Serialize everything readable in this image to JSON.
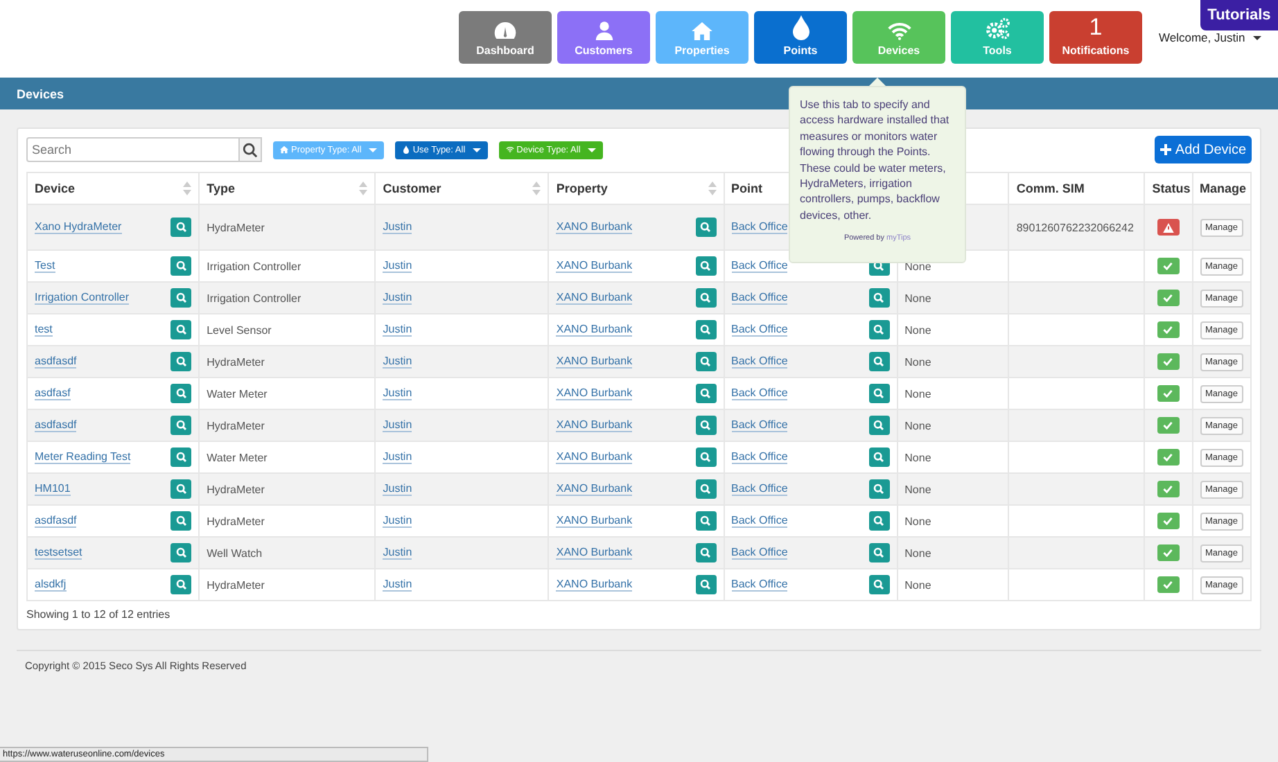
{
  "nav": [
    {
      "label": "Dashboard",
      "color": "#7b7b7b"
    },
    {
      "label": "Customers",
      "color": "#8c70f6"
    },
    {
      "label": "Properties",
      "color": "#5db6fb"
    },
    {
      "label": "Points",
      "color": "#0a6fcf"
    },
    {
      "label": "Devices",
      "color": "#57c35b"
    },
    {
      "label": "Tools",
      "color": "#22c0a0"
    },
    {
      "label": "Notifications",
      "count": "1",
      "color": "#c93f30"
    }
  ],
  "tutorials": "Tutorials",
  "welcome": "Welcome, Justin",
  "page_title": "Devices",
  "search": {
    "placeholder": "Search"
  },
  "filters": [
    {
      "label": "Property Type: All",
      "color": "#5db6fb"
    },
    {
      "label": "Use Type: All",
      "color": "#0b6cc0"
    },
    {
      "label": "Device Type: All",
      "color": "#45b520"
    }
  ],
  "add_button": "Add Device",
  "columns": [
    {
      "label": "Device",
      "sortable": true
    },
    {
      "label": "Type",
      "sortable": true
    },
    {
      "label": "Customer",
      "sortable": true
    },
    {
      "label": "Property",
      "sortable": true
    },
    {
      "label": "Point"
    },
    {},
    {
      "label": "Comm. SIM",
      "sortable": false
    },
    {
      "label": "Status",
      "sortable": false
    },
    {
      "label": "Manage",
      "sortable": false
    }
  ],
  "rows": [
    {
      "device": "Xano HydraMeter",
      "type": "HydraMeter",
      "customer": "Justin",
      "property": "XANO Burbank",
      "point": "Back Office",
      "sim": "8901260762232066242",
      "alert": true,
      "manage": "Manage"
    },
    {
      "device": "Test",
      "type": "Irrigation Controller",
      "customer": "Justin",
      "property": "XANO Burbank",
      "point": "Back Office",
      "column_6": "None",
      "alert": false,
      "manage": "Manage"
    },
    {
      "device": "Irrigation Controller",
      "type": "Irrigation Controller",
      "customer": "Justin",
      "property": "XANO Burbank",
      "point": "Back Office",
      "column_6": "None",
      "alert": false,
      "manage": "Manage"
    },
    {
      "device": "test",
      "type": "Level Sensor",
      "customer": "Justin",
      "property": "XANO Burbank",
      "point": "Back Office",
      "column_6": "None",
      "alert": false,
      "manage": "Manage"
    },
    {
      "device": "asdfasdf",
      "type": "HydraMeter",
      "customer": "Justin",
      "property": "XANO Burbank",
      "point": "Back Office",
      "column_6": "None",
      "alert": false,
      "manage": "Manage"
    },
    {
      "device": "asdfasf",
      "type": "Water Meter",
      "customer": "Justin",
      "property": "XANO Burbank",
      "point": "Back Office",
      "column_6": "None",
      "alert": false,
      "manage": "Manage"
    },
    {
      "device": "asdfasdf",
      "type": "HydraMeter",
      "customer": "Justin",
      "property": "XANO Burbank",
      "point": "Back Office",
      "column_6": "None",
      "alert": false,
      "manage": "Manage"
    },
    {
      "device": "Meter Reading Test",
      "type": "Water Meter",
      "customer": "Justin",
      "property": "XANO Burbank",
      "point": "Back Office",
      "column_6": "None",
      "alert": false,
      "manage": "Manage"
    },
    {
      "device": "HM101",
      "type": "HydraMeter",
      "customer": "Justin",
      "property": "XANO Burbank",
      "point": "Back Office",
      "column_6": "None",
      "alert": false,
      "manage": "Manage"
    },
    {
      "device": "asdfasdf",
      "type": "HydraMeter",
      "customer": "Justin",
      "property": "XANO Burbank",
      "point": "Back Office",
      "column_6": "None",
      "alert": false,
      "manage": "Manage"
    },
    {
      "device": "testsetset",
      "type": "Well Watch",
      "customer": "Justin",
      "property": "XANO Burbank",
      "point": "Back Office",
      "column_6": "None",
      "alert": false,
      "manage": "Manage"
    },
    {
      "device": "alsdkfj",
      "type": "HydraMeter",
      "customer": "Justin",
      "property": "XANO Burbank",
      "point": "Back Office",
      "column_6": "None",
      "alert": false,
      "manage": "Manage"
    }
  ],
  "entries_info": "Showing 1 to 12 of 12 entries",
  "tooltip": {
    "text": "Use this tab to specify and access hardware installed that measures or monitors water flowing through the Points. These could be water meters, HydraMeters, irrigation controllers, pumps, backflow devices, other.",
    "powered_by": "Powered by",
    "brand": "myTips"
  },
  "copyright": "Copyright © 2015 Seco Sys All Rights Reserved",
  "status_url": "https://www.wateruseonline.com/devices"
}
